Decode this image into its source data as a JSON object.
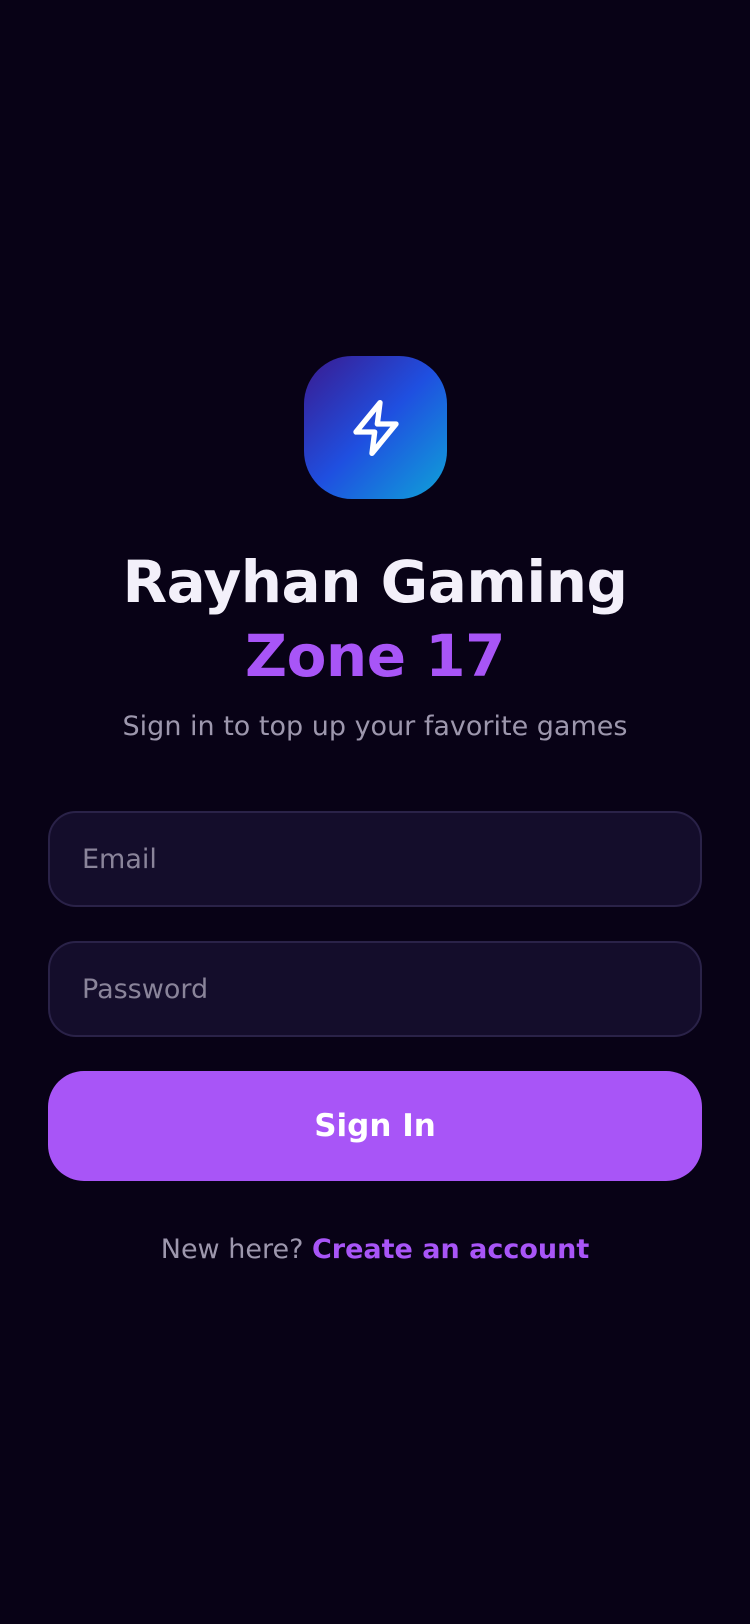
{
  "app": {
    "title_main": "Rayhan Gaming ",
    "title_accent": "Zone 17",
    "subtitle": "Sign in to top up your favorite games",
    "logo_icon": "lightning-bolt-icon"
  },
  "form": {
    "email_placeholder": "Email",
    "email_value": "",
    "password_placeholder": "Password",
    "password_value": "",
    "submit_label": "Sign In"
  },
  "footer": {
    "prompt": "New here? ",
    "link_label": "Create an account"
  },
  "colors": {
    "background": "#080216",
    "accent": "#a855f7",
    "field_bg": "#140d2b",
    "field_border": "#2a2248",
    "muted_text": "#9d97ad"
  }
}
